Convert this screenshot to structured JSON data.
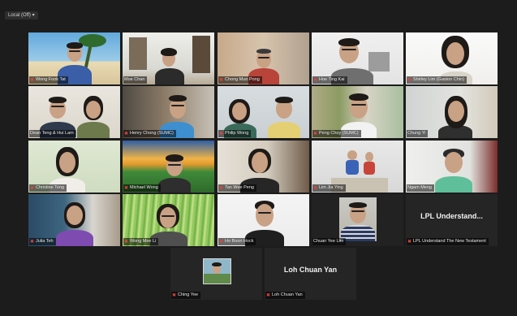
{
  "toolbar": {
    "status_badge": "Local (Off)",
    "chevron": "▾"
  },
  "participants": [
    {
      "name": "Wong Fook Tat"
    },
    {
      "name": "Moe Chan"
    },
    {
      "name": "Chong Mun Pong"
    },
    {
      "name": "Hoe Ting Kai"
    },
    {
      "name": "Shirley Lim (Gaston Chin)"
    },
    {
      "name": "Dean Teng & Hui Lam"
    },
    {
      "name": "Henry Chong (SUMC)"
    },
    {
      "name": "Philip Wong"
    },
    {
      "name": "Hamlin Leong"
    },
    {
      "name": "Peng Choy (SUMC)"
    },
    {
      "name": "Chung Yi"
    },
    {
      "name": "Christine Tong"
    },
    {
      "name": "Michael Wong"
    },
    {
      "name": "Tan Wee Peng"
    },
    {
      "name": "Lim Jia Ying"
    },
    {
      "name": "Ngam Meng"
    },
    {
      "name": "Julia Teh"
    },
    {
      "name": "Wong Mee Li"
    },
    {
      "name": "Ho Boon Hock"
    },
    {
      "name": "Chuan Yee Lim"
    },
    {
      "name": "LPL Understand The New Testament",
      "display": "LPL Understand..."
    },
    {
      "name": "Ching Yee"
    },
    {
      "name": "Loh Chuan Yan",
      "display": "Loh Chuan Yan"
    }
  ],
  "icons": {
    "muted_mic": "mic-muted-icon"
  },
  "colors": {
    "active_speaker": "#d7d25a",
    "muted": "#e0463a",
    "window_bg": "#1c1c1c"
  }
}
